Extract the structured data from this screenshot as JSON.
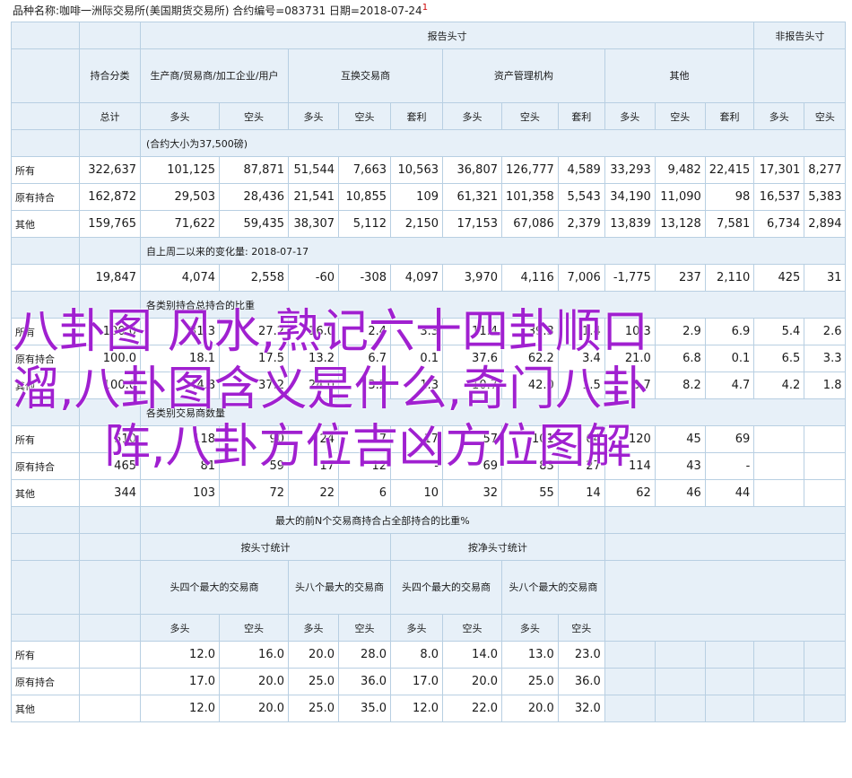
{
  "header": {
    "text": "品种名称:咖啡一洲际交易所(美国期货交易所)   合约编号=083731   日期=2018-07-24",
    "mark": "1"
  },
  "cols": {
    "report_header": "报告头寸",
    "nonreport_header": "非报告头寸",
    "category": "持合分类",
    "g1": "生产商/贸易商/加工企业/用户",
    "g2": "互换交易商",
    "g3": "资产管理机构",
    "g4": "其他",
    "total": "总计",
    "long": "多头",
    "short": "空头",
    "arb": "套利"
  },
  "rows": {
    "all": "所有",
    "old": "原有持合",
    "other": "其他"
  },
  "sections": {
    "s1_note": "(合约大小为37,500磅)",
    "s2_note": "自上周二以来的变化量: 2018-07-17",
    "s3_note": "各类别持合总持合的比重",
    "s4_note": "各类别交易商数量"
  },
  "s1": {
    "all": [
      "322,637",
      "101,125",
      "87,871",
      "51,544",
      "7,663",
      "10,563",
      "36,807",
      "126,777",
      "4,589",
      "33,293",
      "9,482",
      "22,415",
      "17,301",
      "8,277"
    ],
    "old": [
      "162,872",
      "29,503",
      "28,436",
      "21,541",
      "10,855",
      "109",
      "61,321",
      "101,358",
      "5,543",
      "34,190",
      "11,090",
      "98",
      "16,537",
      "5,383"
    ],
    "other": [
      "159,765",
      "71,622",
      "59,435",
      "38,307",
      "5,112",
      "2,150",
      "17,153",
      "67,086",
      "2,379",
      "13,839",
      "13,128",
      "7,581",
      "6,734",
      "2,894"
    ]
  },
  "s2": [
    "19,847",
    "4,074",
    "2,558",
    "-60",
    "-308",
    "4,097",
    "3,970",
    "4,116",
    "7,006",
    "-1,775",
    "237",
    "2,110",
    "425",
    "31"
  ],
  "s3": {
    "all": [
      "100.0",
      "31.3",
      "27.2",
      "16.0",
      "2.4",
      "3.3",
      "11.4",
      "39.3",
      "1.4",
      "10.3",
      "2.9",
      "6.9",
      "5.4",
      "2.6"
    ],
    "old": [
      "100.0",
      "18.1",
      "17.5",
      "13.2",
      "6.7",
      "0.1",
      "37.6",
      "62.2",
      "3.4",
      "21.0",
      "6.8",
      "0.1",
      "6.5",
      "3.3"
    ],
    "other": [
      "100.0",
      "44.8",
      "37.2",
      "24.0",
      "3.2",
      "1.3",
      "10.7",
      "42.0",
      "1.5",
      "8.7",
      "8.2",
      "4.7",
      "4.2",
      "1.8"
    ]
  },
  "s4": {
    "all": [
      "510",
      "118",
      "90",
      "24",
      "7",
      "17",
      "57",
      "101",
      "64",
      "120",
      "45",
      "69"
    ],
    "old": [
      "465",
      "81",
      "59",
      "17",
      "12",
      "-",
      "69",
      "83",
      "27",
      "114",
      "43",
      "-"
    ],
    "other": [
      "344",
      "103",
      "72",
      "22",
      "6",
      "10",
      "32",
      "55",
      "14",
      "62",
      "46",
      "44"
    ]
  },
  "s5": {
    "title": "最大的前N个交易商持合占全部持合的比重%",
    "gross": "按头寸统计",
    "net": "按净头寸统计",
    "top4": "头四个最大的交易商",
    "top8": "头八个最大的交易商",
    "all": [
      "12.0",
      "16.0",
      "20.0",
      "28.0",
      "8.0",
      "14.0",
      "13.0",
      "23.0"
    ],
    "old": [
      "17.0",
      "20.0",
      "25.0",
      "36.0",
      "17.0",
      "20.0",
      "25.0",
      "36.0"
    ],
    "other": [
      "12.0",
      "20.0",
      "25.0",
      "35.0",
      "12.0",
      "22.0",
      "20.0",
      "32.0"
    ]
  },
  "overlay": {
    "line1": "八卦图 风水,熟记六十四卦顺口",
    "line2": "溜,八卦图含义是什么,奇门八卦",
    "line3": "阵,八卦方位吉凶方位图解"
  }
}
